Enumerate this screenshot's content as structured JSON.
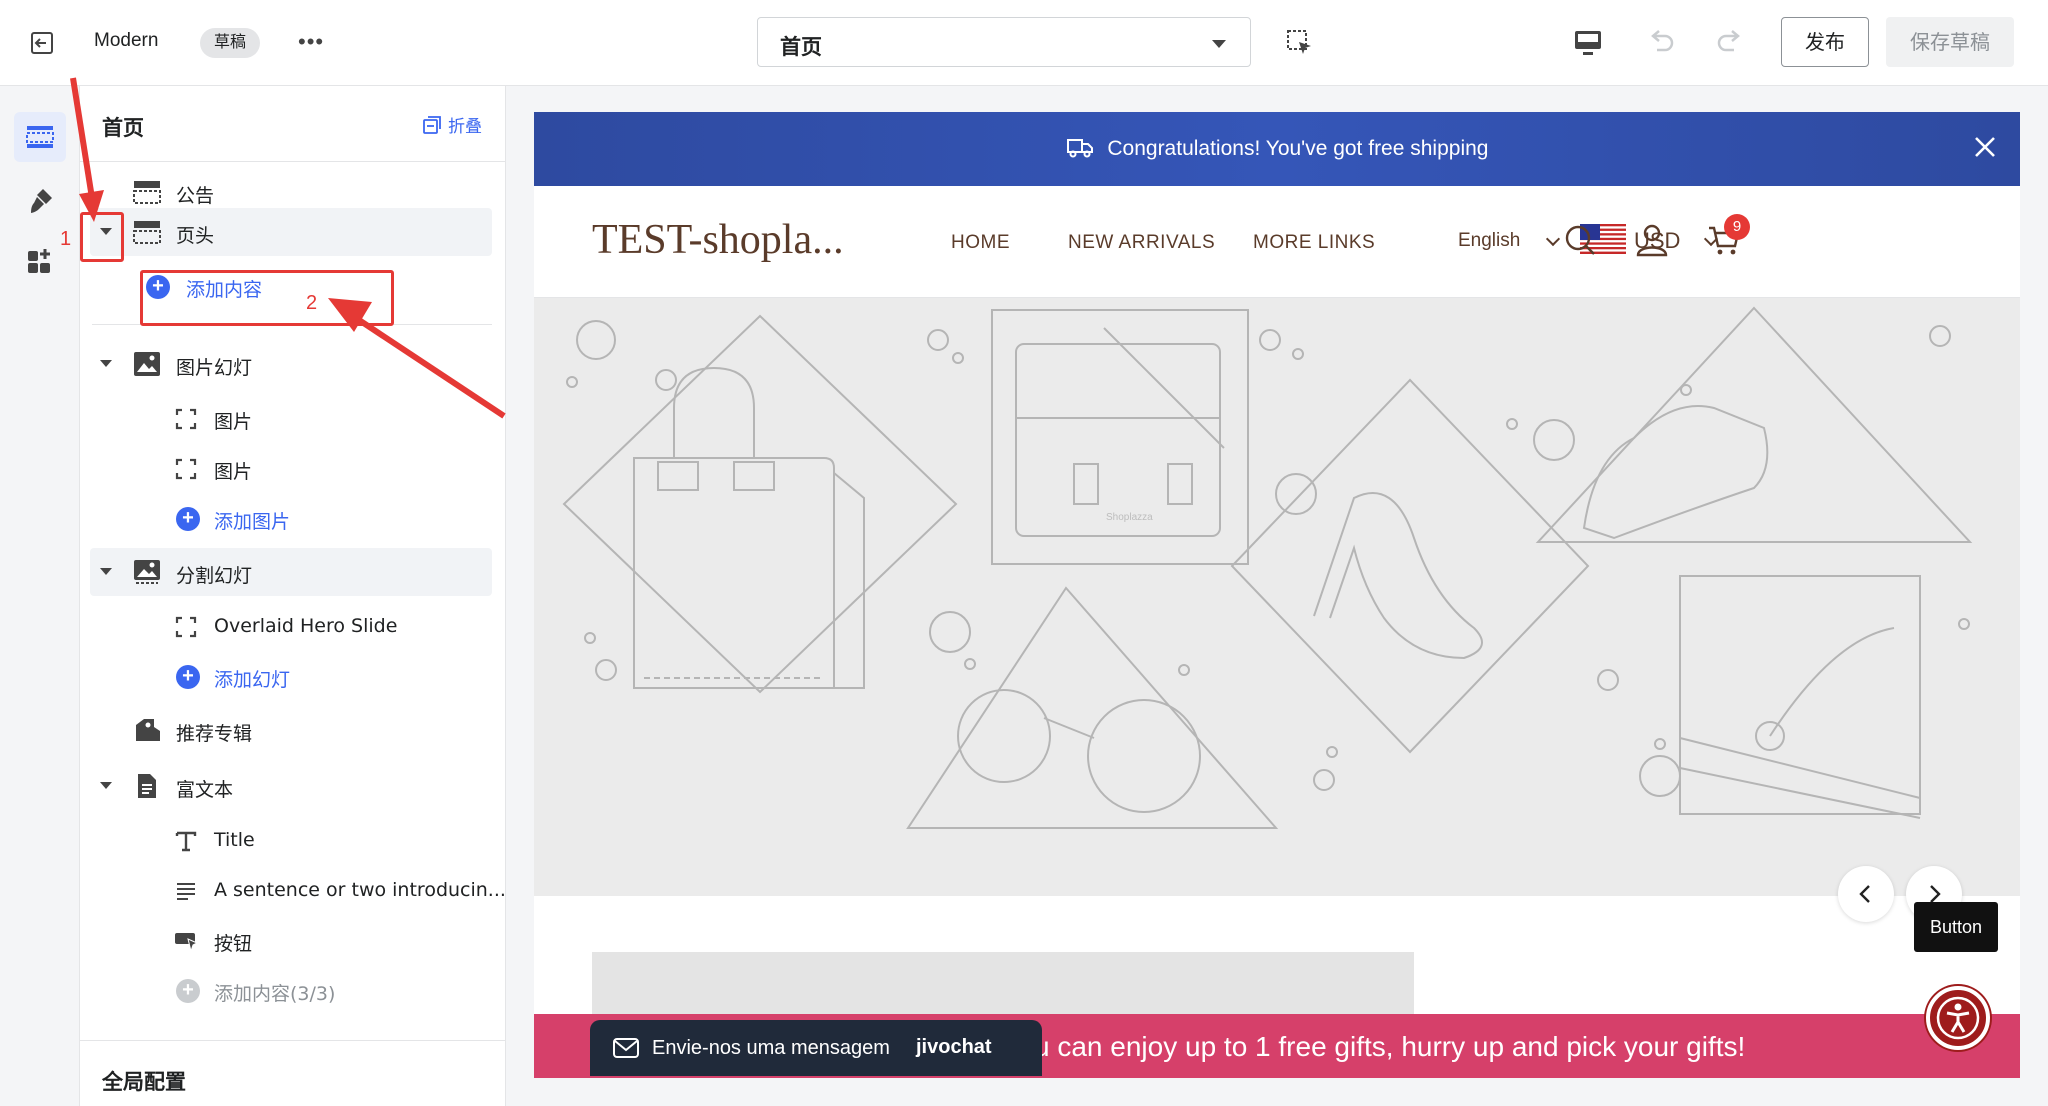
{
  "topbar": {
    "theme_name": "Modern",
    "status_badge": "草稿",
    "more_label": "•••",
    "page_selector": "首页",
    "publish_label": "发布",
    "save_draft_label": "保存草稿"
  },
  "sidebar": {
    "title": "首页",
    "fold_label": "折叠",
    "items": [
      {
        "label": "公告"
      },
      {
        "label": "页头"
      },
      {
        "label": "添加内容"
      },
      {
        "label": "图片幻灯"
      },
      {
        "label": "图片"
      },
      {
        "label": "图片"
      },
      {
        "label": "添加图片"
      },
      {
        "label": "分割幻灯"
      },
      {
        "label": "Overlaid Hero Slide"
      },
      {
        "label": "添加幻灯"
      },
      {
        "label": "推荐专辑"
      },
      {
        "label": "富文本"
      },
      {
        "label": "Title"
      },
      {
        "label": "A sentence or two introducin..."
      },
      {
        "label": "按钮"
      },
      {
        "label": "添加内容(3/3)"
      }
    ],
    "global_config": "全局配置"
  },
  "annotations": {
    "step1": "1",
    "step2": "2"
  },
  "preview": {
    "announcement": "Congratulations!  You've got free shipping",
    "logo": "TEST-shopla...",
    "nav": [
      "HOME",
      "NEW ARRIVALS",
      "MORE LINKS"
    ],
    "language": "English",
    "currency": "USD",
    "cart_count": "9",
    "hero_watermark": "Shoplazza",
    "tooltip": "Button",
    "promo": "u can enjoy up to 1 free gifts, hurry up and pick your gifts!",
    "chat_text": "Envie-nos uma mensagem",
    "chat_brand": "jivochat"
  },
  "colors": {
    "accent": "#3a66f0",
    "announcement_bg": "#2f4ea8",
    "promo_bg": "#d6406a",
    "annotation": "#e53935",
    "brand_text": "#5a3b2a"
  }
}
